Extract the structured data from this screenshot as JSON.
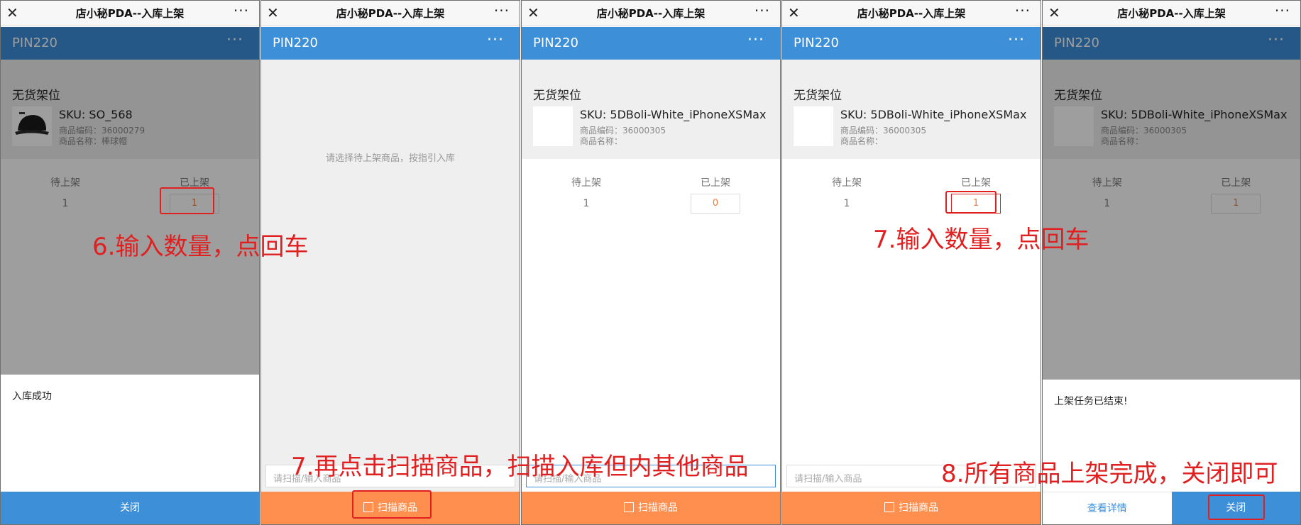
{
  "app_title": "店小秘PDA--入库上架",
  "nav_title": "PIN220",
  "more_glyph": "···",
  "close_glyph": "✕",
  "shelf_label": "无货架位",
  "pending_label": "待上架",
  "done_label": "已上架",
  "search_placeholder": "请扫描/输入商品",
  "scan_label": "扫描商品",
  "panels": [
    {
      "sku": "SKU: SO_568",
      "code": "商品编码：36000279",
      "name": "商品名称：棒球帽",
      "pending": "1",
      "done": "1",
      "sheet_msg": "入库成功",
      "sheet_button": "关闭"
    },
    {
      "empty_msg": "请选择待上架商品，按指引入库"
    },
    {
      "sku": "SKU: 5DBoli-White_iPhoneXSMax",
      "code": "商品编码：36000305",
      "name": "商品名称：",
      "pending": "1",
      "done": "0"
    },
    {
      "sku": "SKU: 5DBoli-White_iPhoneXSMax",
      "code": "商品编码：36000305",
      "name": "商品名称：",
      "pending": "1",
      "done": "1"
    },
    {
      "sku": "SKU: 5DBoli-White_iPhoneXSMax",
      "code": "商品编码：36000305",
      "name": "商品名称：",
      "pending": "1",
      "done": "1",
      "sheet_msg": "上架任务已结束!",
      "detail_button": "查看详情",
      "sheet_button": "关闭"
    }
  ],
  "annotations": {
    "step6": "6.输入数量，点回车",
    "step7a": "7.再点击扫描商品，扫描入库但内其他商品",
    "step7b": "7.输入数量，点回车",
    "step8": "8.所有商品上架完成，关闭即可"
  },
  "colors": {
    "header_blue": "#3d8fd8",
    "scan_orange": "#ff8f4f",
    "annotation_red": "#e02020"
  }
}
